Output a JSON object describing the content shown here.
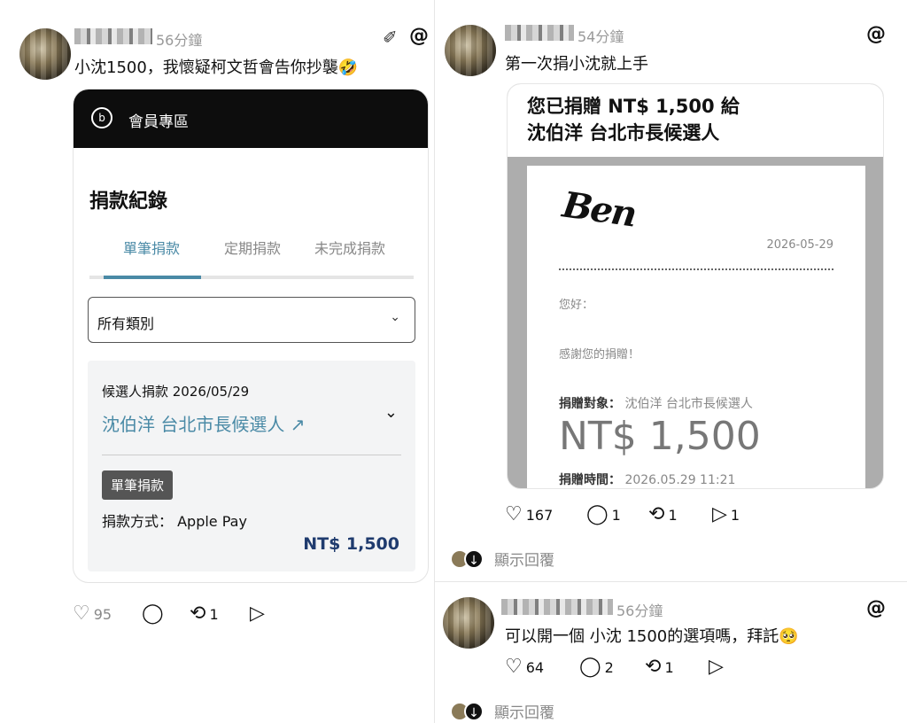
{
  "post1": {
    "time": "56分鐘",
    "text": "小沈1500，我懷疑柯文哲會告你抄襲🤣",
    "screenshot": {
      "header_title": "會員專區",
      "heading": "捐款紀錄",
      "tabs": [
        "單筆捐款",
        "定期捐款",
        "未完成捐款"
      ],
      "filter": "所有類別",
      "record_line1": "候選人捐款 2026/05/29",
      "record_target": "沈伯洋 台北市長候選人 ↗",
      "record_badge": "單筆捐款",
      "record_payment": "捐款方式： Apple Pay",
      "record_amount": "NT$ 1,500"
    },
    "actions": {
      "likes": "95",
      "comments": "",
      "reposts": "1",
      "shares": ""
    }
  },
  "post2": {
    "time": "54分鐘",
    "text": "第一次捐小沈就上手",
    "screenshot": {
      "title_line1": "您已捐贈 NT$ 1,500 給",
      "title_line2": "沈伯洋 台北市長候選人",
      "logo": "Ben",
      "date": "2026-05-29",
      "greeting": "您好：",
      "thanks": "感謝您的捐贈！",
      "target_label": "捐贈對象：",
      "target_value": "沈伯洋 台北市長候選人",
      "amount": "NT$ 1,500",
      "time_label": "捐贈時間：",
      "time_value": "2026.05.29 11:21"
    },
    "actions": {
      "likes": "167",
      "comments": "1",
      "reposts": "1",
      "shares": "1"
    },
    "show_replies": "顯示回覆"
  },
  "post3": {
    "time": "56分鐘",
    "text": "可以開一個 小沈 1500的選項嗎，拜託🥺",
    "actions": {
      "likes": "64",
      "comments": "2",
      "reposts": "1",
      "shares": ""
    },
    "show_replies": "顯示回覆"
  }
}
